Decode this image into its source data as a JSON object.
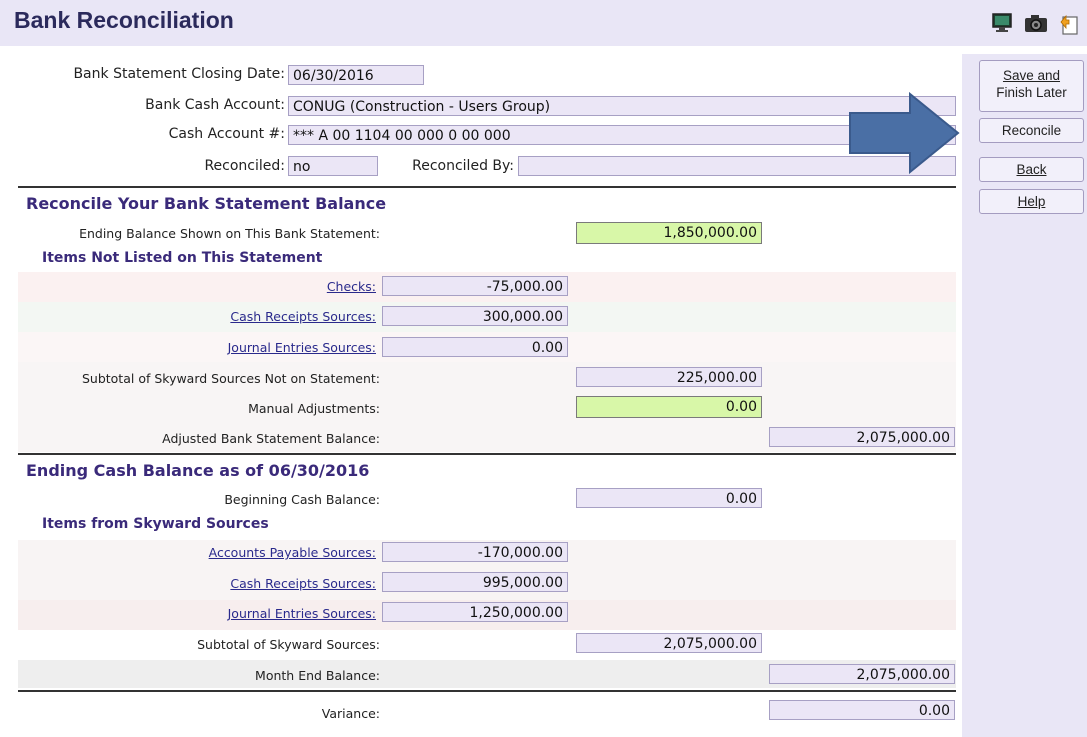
{
  "window": {
    "title": "Bank Reconciliation",
    "toolbar_icons": [
      "monitor-icon",
      "camera-icon",
      "clipboard-icon"
    ]
  },
  "header": {
    "closing_date_label": "Bank Statement Closing Date:",
    "closing_date_value": "06/30/2016",
    "bank_cash_account_label": "Bank Cash Account:",
    "bank_cash_account_value": "CONUG (Construction - Users Group)",
    "cash_account_num_label": "Cash Account #:",
    "cash_account_num_value": "*** A 00 1104 00 000 0 00 000",
    "reconciled_label": "Reconciled:",
    "reconciled_value": "no",
    "reconciled_by_label": "Reconciled By:",
    "reconciled_by_value": ""
  },
  "statement_section": {
    "heading": "Reconcile Your Bank Statement Balance",
    "ending_balance_label": "Ending Balance Shown on This Bank Statement:",
    "ending_balance_value": "1,850,000.00",
    "items_heading": "Items Not Listed on This Statement",
    "checks_label": "Checks:",
    "checks_value": "-75,000.00",
    "cash_receipts_label": "Cash Receipts Sources:",
    "cash_receipts_value": "300,000.00",
    "journal_entries_label": "Journal Entries Sources:",
    "journal_entries_value": "0.00",
    "subtotal_label": "Subtotal of Skyward Sources Not on Statement:",
    "subtotal_value": "225,000.00",
    "manual_adj_label": "Manual Adjustments:",
    "manual_adj_value": "0.00",
    "adjusted_label": "Adjusted Bank Statement Balance:",
    "adjusted_value": "2,075,000.00"
  },
  "cash_section": {
    "heading": "Ending Cash Balance as of 06/30/2016",
    "beginning_label": "Beginning Cash Balance:",
    "beginning_value": "0.00",
    "items_heading": "Items from Skyward Sources",
    "ap_label": "Accounts Payable Sources:",
    "ap_value": "-170,000.00",
    "cash_receipts_label": "Cash Receipts Sources:",
    "cash_receipts_value": "995,000.00",
    "journal_entries_label": "Journal Entries Sources:",
    "journal_entries_value": "1,250,000.00",
    "subtotal_label": "Subtotal of Skyward Sources:",
    "subtotal_value": "2,075,000.00",
    "month_end_label": "Month End Balance:",
    "month_end_value": "2,075,000.00",
    "variance_label": "Variance:",
    "variance_value": "0.00"
  },
  "sidebar": {
    "save_line1": "Save and",
    "save_line2": "Finish Later",
    "reconcile": "Reconcile",
    "back": "Back",
    "help": "Help"
  },
  "colors": {
    "titlebar": "#e9e6f6",
    "heading": "#3a2a7a",
    "field": "#ebe6f6",
    "highlight_field": "#d8f7a8",
    "arrow": "#4a6fa5"
  }
}
